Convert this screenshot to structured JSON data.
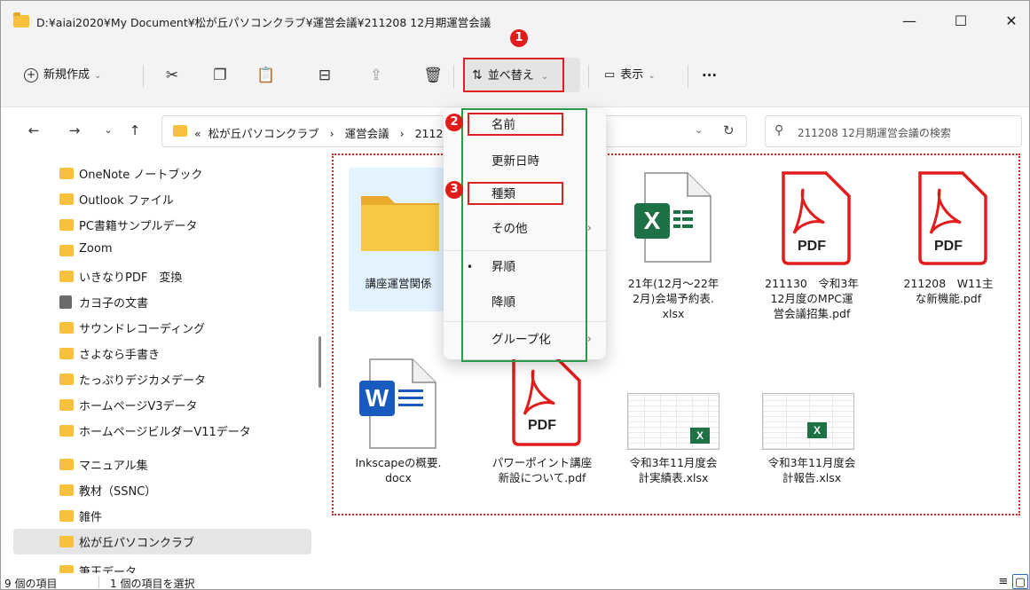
{
  "window": {
    "title": "D:¥aiai2020¥My Document¥松が丘パソコンクラブ¥運営会議¥211208 12月期運営会議",
    "minimize": "—",
    "maximize": "☐",
    "close": "✕"
  },
  "toolbar": {
    "new_label": "新規作成",
    "sort_label": "並べ替え",
    "view_label": "表示",
    "more_label": "···"
  },
  "address": {
    "prefix": "«",
    "crumbs": [
      "松が丘パソコンクラブ",
      "運営会議",
      "211208 12月期運営会議"
    ],
    "search_placeholder": "211208 12月期運営会議の検索"
  },
  "sidebar": {
    "items": [
      {
        "label": "OneNote ノートブック",
        "icon": "folder"
      },
      {
        "label": "Outlook ファイル",
        "icon": "folder"
      },
      {
        "label": "PC書籍サンプルデータ",
        "icon": "folder"
      },
      {
        "label": "Zoom",
        "icon": "folder"
      },
      {
        "label": "いきなりPDF　変換",
        "icon": "folder"
      },
      {
        "label": "カヨ子の文書",
        "icon": "document"
      },
      {
        "label": "サウンドレコーディング",
        "icon": "folder"
      },
      {
        "label": "さよなら手書き",
        "icon": "folder"
      },
      {
        "label": "たっぷりデジカメデータ",
        "icon": "folder"
      },
      {
        "label": "ホームページV3データ",
        "icon": "folder"
      },
      {
        "label": "ホームページビルダーV11データ",
        "icon": "folder"
      },
      {
        "label": "マニュアル集",
        "icon": "folder"
      },
      {
        "label": "教材（SSNC）",
        "icon": "folder"
      },
      {
        "label": "雑件",
        "icon": "folder"
      },
      {
        "label": "松が丘パソコンクラブ",
        "icon": "folder",
        "selected": true
      },
      {
        "label": "筆王データ",
        "icon": "folder"
      }
    ]
  },
  "files": [
    {
      "name": "講座運営関係",
      "type": "folder"
    },
    {
      "name": "21年(12月～22年2月)会場予約表.xlsx",
      "line1": "21年(12月～22年",
      "line2": "2月)会場予約表.",
      "line3": "xlsx",
      "type": "excel"
    },
    {
      "name": "211130　令和3年12月度のMPC運営会議招集.pdf",
      "line1": "211130　令和3年",
      "line2": "12月度のMPC運",
      "line3": "営会議招集.pdf",
      "type": "pdf"
    },
    {
      "name": "211208　W11主な新機能.pdf",
      "line1": "211208　W11主",
      "line2": "な新機能.pdf",
      "type": "pdf"
    },
    {
      "name": "Inkscapeの概要.docx",
      "line1": "Inkscapeの概要.",
      "line2": "docx",
      "type": "word"
    },
    {
      "name": "パワーポイント講座新設について.pdf",
      "line1": "パワーポイント講座",
      "line2": "新設について.pdf",
      "type": "pdf"
    },
    {
      "name": "令和3年11月度会計実績表.xlsx",
      "line1": "令和3年11月度会",
      "line2": "計実績表.xlsx",
      "type": "excel-thumb"
    },
    {
      "name": "令和3年11月度会計報告.xlsx",
      "line1": "令和3年11月度会",
      "line2": "計報告.xlsx",
      "type": "excel-thumb"
    }
  ],
  "pdf_badge": "PDF",
  "excel_badge": "X",
  "word_badge": "W",
  "sort_menu": {
    "items": [
      "名前",
      "更新日時",
      "種類",
      "その他",
      "昇順",
      "降順",
      "グループ化"
    ],
    "active_order": "昇順"
  },
  "annotations": {
    "badge1": "1",
    "badge2": "2",
    "badge3": "3"
  },
  "status": {
    "count": "9 個の項目",
    "selected": "1 個の項目を選択"
  },
  "colors": {
    "accent_red": "#e02020",
    "accent_green": "#2a9a4a",
    "folder_yellow": "#f7c13b",
    "excel_green": "#1e7145",
    "word_blue": "#185abd"
  }
}
